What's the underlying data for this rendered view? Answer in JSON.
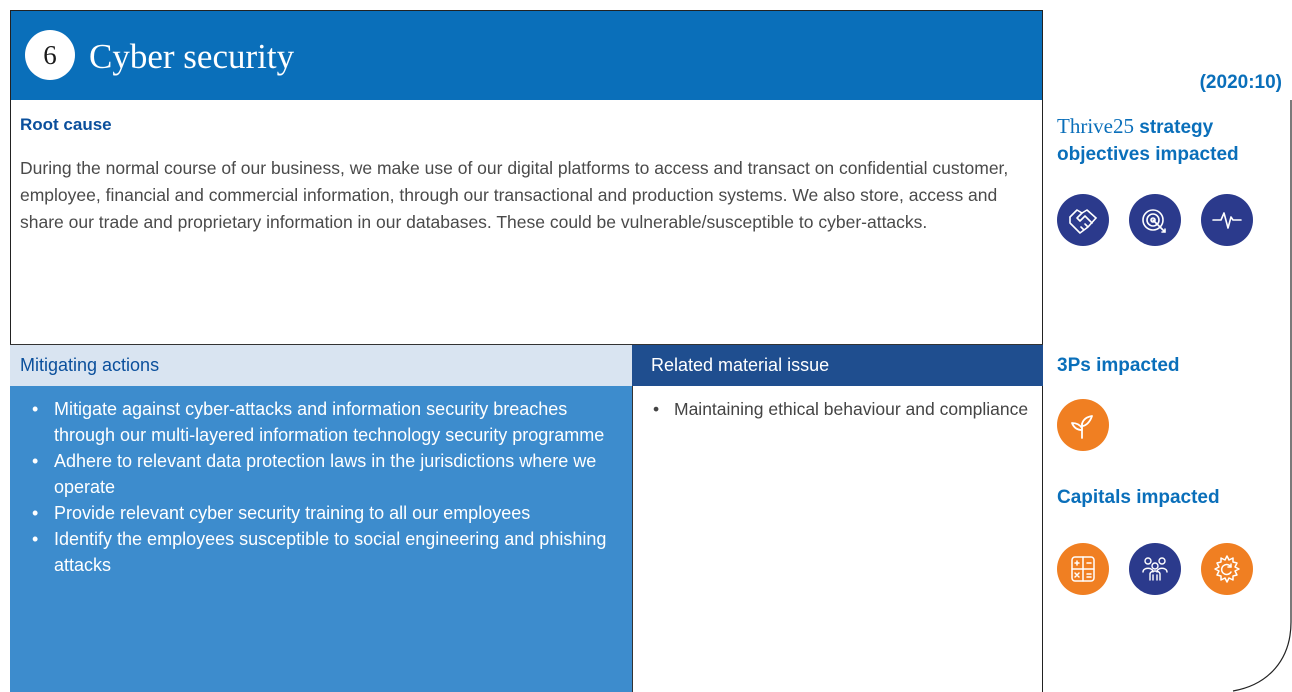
{
  "header": {
    "number": "6",
    "title": "Cyber security",
    "code": "(2020:10)"
  },
  "root_cause": {
    "title": "Root cause",
    "text": "During the normal course of our business, we make use of our digital platforms to access and transact on confidential customer, employee, financial and commercial information, through our transactional and production systems. We also store, access and share our trade and proprietary information in our databases. These could be vulnerable/susceptible to cyber-attacks."
  },
  "mitigating": {
    "title": "Mitigating actions",
    "items": [
      "Mitigate against cyber-attacks and information security breaches through our multi-layered information technology security programme",
      "Adhere to relevant data protection laws in the jurisdictions where we operate",
      "Provide relevant cyber security training to all our employees",
      "Identify the employees susceptible to social engineering and phishing attacks"
    ]
  },
  "related": {
    "title": "Related material issue",
    "items": [
      "Maintaining ethical behaviour and compliance"
    ]
  },
  "sidebar": {
    "thrive_brand": "Thrive25",
    "thrive_rest": "strategy",
    "thrive_line2": "objectives impacted",
    "thrive_icons": [
      "handshake-icon",
      "target-icon",
      "heartbeat-icon"
    ],
    "threeps_title": "3Ps impacted",
    "threeps_icons": [
      "sprout-icon"
    ],
    "capitals_title": "Capitals impacted",
    "capitals_icons": [
      "calculator-icon",
      "people-icon",
      "gear-icon"
    ]
  },
  "colors": {
    "header_blue": "#0a6fba",
    "dark_navy": "#1f4e8f",
    "icon_navy": "#2b3a8c",
    "mid_blue": "#3d8ccd",
    "orange": "#f07f22",
    "light_blue": "#d9e4f1"
  }
}
